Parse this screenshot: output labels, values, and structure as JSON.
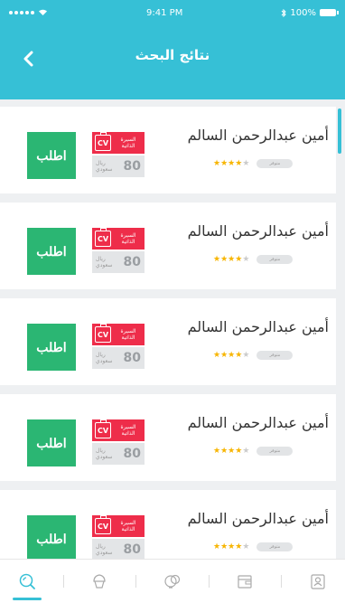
{
  "status_bar": {
    "time": "9:41 PM",
    "battery": "100%"
  },
  "header": {
    "title": "نتائج البحث",
    "back_icon": "chevron-left-icon"
  },
  "colors": {
    "accent": "#36c0d6",
    "order_button": "#2bb673",
    "cv_badge": "#ee2d4a",
    "star": "#f7b500"
  },
  "results": [
    {
      "name": "أمين عبدالرحمن السالم",
      "price": "80",
      "currency": "ريال سعودي",
      "cv_label": "السيرة الذاتية",
      "status": "متوفر",
      "rating": 4,
      "rating_max": 5,
      "order_label": "اطلب"
    },
    {
      "name": "أمين عبدالرحمن السالم",
      "price": "80",
      "currency": "ريال سعودي",
      "cv_label": "السيرة الذاتية",
      "status": "متوفر",
      "rating": 4,
      "rating_max": 5,
      "order_label": "اطلب"
    },
    {
      "name": "أمين عبدالرحمن السالم",
      "price": "80",
      "currency": "ريال سعودي",
      "cv_label": "السيرة الذاتية",
      "status": "متوفر",
      "rating": 4,
      "rating_max": 5,
      "order_label": "اطلب"
    },
    {
      "name": "أمين عبدالرحمن السالم",
      "price": "80",
      "currency": "ريال سعودي",
      "cv_label": "السيرة الذاتية",
      "status": "متوفر",
      "rating": 4,
      "rating_max": 5,
      "order_label": "اطلب"
    },
    {
      "name": "أمين عبدالرحمن السالم",
      "price": "80",
      "currency": "ريال سعودي",
      "cv_label": "السيرة الذاتية",
      "status": "متوفر",
      "rating": 4,
      "rating_max": 5,
      "order_label": "اطلب"
    }
  ],
  "tab_bar": {
    "tabs": [
      {
        "icon": "search-icon",
        "active": true
      },
      {
        "icon": "cupcake-icon",
        "active": false
      },
      {
        "icon": "drinks-icon",
        "active": false
      },
      {
        "icon": "wallet-icon",
        "active": false
      },
      {
        "icon": "profile-icon",
        "active": false
      }
    ]
  }
}
